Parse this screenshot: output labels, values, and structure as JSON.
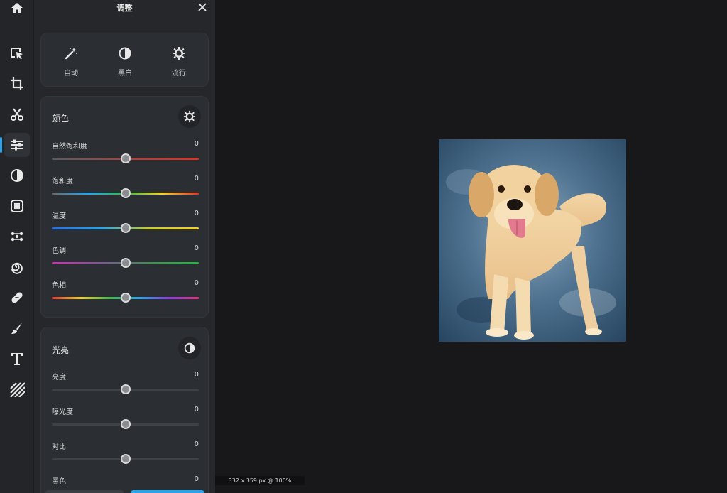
{
  "panel": {
    "title": "调整"
  },
  "presets": [
    {
      "label": "自动",
      "icon": "magic-wand-icon"
    },
    {
      "label": "黑白",
      "icon": "contrast-icon"
    },
    {
      "label": "流行",
      "icon": "sun-gear-icon"
    }
  ],
  "color_section": {
    "title": "颜色",
    "icon": "color-gear-icon",
    "sliders": [
      {
        "label": "自然饱和度",
        "value": "0",
        "position": 0.5,
        "track": [
          "#5a5c60",
          "#d9342b"
        ]
      },
      {
        "label": "饱和度",
        "value": "0",
        "position": 0.5,
        "track": [
          "#6a6a6a",
          "#2aa3e8",
          "#3cb54a",
          "#f2d22e",
          "#e0342b"
        ]
      },
      {
        "label": "温度",
        "value": "0",
        "position": 0.5,
        "track": [
          "#2a6fe0",
          "#2aa3e8",
          "#c8cc2e",
          "#f2d22e"
        ]
      },
      {
        "label": "色调",
        "value": "0",
        "position": 0.5,
        "track": [
          "#c23aa8",
          "#7a5a90",
          "#4a8a5a",
          "#2db34a"
        ]
      },
      {
        "label": "色相",
        "value": "0",
        "position": 0.5,
        "track": [
          "#e03232",
          "#f2d22e",
          "#3cb54a",
          "#2aa3e8",
          "#8a3ae0",
          "#e03280"
        ]
      }
    ]
  },
  "light_section": {
    "title": "光亮",
    "icon": "half-circle-icon",
    "sliders": [
      {
        "label": "亮度",
        "value": "0",
        "position": 0.5
      },
      {
        "label": "曝光度",
        "value": "0",
        "position": 0.5
      },
      {
        "label": "对比",
        "value": "0",
        "position": 0.5
      },
      {
        "label": "黑色",
        "value": "0",
        "position": 0.5
      }
    ]
  },
  "status": {
    "text": "332 x 359 px @ 100%"
  },
  "colors": {
    "accent": "#2aa3e8",
    "panel": "#25272b",
    "canvas": "#18181a"
  }
}
